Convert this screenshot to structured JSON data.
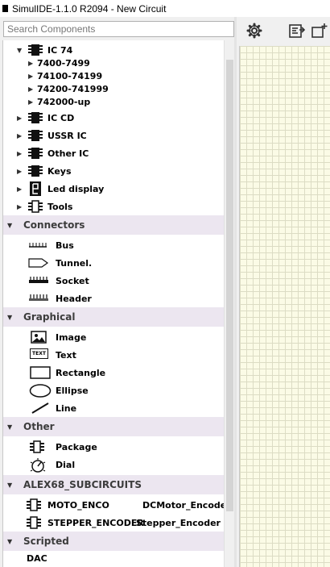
{
  "window": {
    "title": "SimulIDE-1.1.0 R2094 - New Circuit"
  },
  "search": {
    "placeholder": "Search Components"
  },
  "tree": {
    "ic74": {
      "label": "IC 74",
      "children": [
        "7400-7499",
        "74100-74199",
        "74200-741999",
        "742000-up"
      ]
    },
    "collapsed": [
      {
        "label": "IC CD",
        "icon": "chip-icon"
      },
      {
        "label": "USSR IC",
        "icon": "chip-icon"
      },
      {
        "label": "Other IC",
        "icon": "chip-icon"
      },
      {
        "label": "Keys",
        "icon": "chip-icon"
      },
      {
        "label": "Led display",
        "icon": "seven-segment-icon"
      },
      {
        "label": "Tools",
        "icon": "package-icon"
      }
    ],
    "connectors": {
      "label": "Connectors",
      "items": [
        {
          "label": "Bus",
          "icon": "bus-icon"
        },
        {
          "label": "Tunnel.",
          "icon": "tunnel-icon"
        },
        {
          "label": "Socket",
          "icon": "socket-icon"
        },
        {
          "label": "Header",
          "icon": "header-icon"
        }
      ]
    },
    "graphical": {
      "label": "Graphical",
      "items": [
        {
          "label": "Image",
          "icon": "image-icon"
        },
        {
          "label": "Text",
          "icon": "text-icon",
          "badge": "TEXT"
        },
        {
          "label": "Rectangle",
          "icon": "rectangle-icon"
        },
        {
          "label": "Ellipse",
          "icon": "ellipse-icon"
        },
        {
          "label": "Line",
          "icon": "line-icon"
        }
      ]
    },
    "other": {
      "label": "Other",
      "items": [
        {
          "label": "Package",
          "icon": "package-icon"
        },
        {
          "label": "Dial",
          "icon": "dial-icon"
        }
      ]
    },
    "subcircuits": {
      "label": "ALEX68_SUBCIRCUITS",
      "items": [
        {
          "label": "MOTO_ENCO",
          "desc": "DCMotor_Encoder",
          "icon": "package-icon"
        },
        {
          "label": "STEPPER_ENCODER",
          "desc": "Stepper_Encoder",
          "icon": "package-icon"
        }
      ]
    },
    "scripted": {
      "label": "Scripted",
      "items": [
        {
          "label": "DAC"
        }
      ]
    }
  },
  "colors": {
    "category_bg": "#ece6f0",
    "canvas_bg": "#fbfbe6",
    "grid": "#dcdcc4"
  }
}
